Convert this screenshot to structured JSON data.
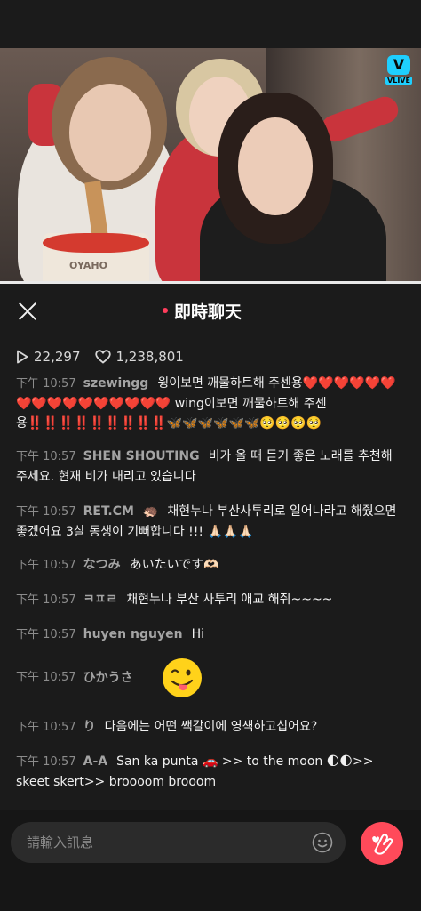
{
  "video": {
    "badge_label": "VLIVE",
    "cup_text": "OYAHO"
  },
  "chat": {
    "title": "即時聊天",
    "views": "22,297",
    "likes": "1,238,801"
  },
  "messages": [
    {
      "time": "下午 10:57",
      "user": "szewingg",
      "text_a": "윙이보면 깨물하트해 주센용",
      "hearts_a": "❤️❤️❤️❤️❤️",
      "hearts_b": "❤️❤️❤️❤️❤️❤️❤️❤️❤️❤️❤️",
      "text_b": " wing이보면 깨물하트해 주센",
      "text_c": "용",
      "bangs": "‼️‼️‼️‼️‼️‼️‼️‼️‼️",
      "butterflies": "🦋🦋🦋🦋🦋🦋",
      "pleading": "🥺🥺🥺🥺"
    },
    {
      "time": "下午 10:57",
      "user": "SHEN SHOUTING",
      "text": "비가 올 때 듣기 좋은 노래를 추천해 주세요. 현재 비가 내리고 있습니다"
    },
    {
      "time": "下午 10:57",
      "user": "RET.CM",
      "user_emoji": "🦔",
      "text": "채현누나 부산사투리로 일어나라고 해줬으면 좋겠어요 3살 동생이 기뻐합니다 !!! ",
      "hands": "🙏🏻🙏🏻🙏🏻"
    },
    {
      "time": "下午 10:57",
      "user": "なつみ",
      "text": "あいたいです",
      "emoji": "🫶🏻"
    },
    {
      "time": "下午 10:57",
      "user": "ㅋㅍㄹ",
      "text": "채현누나 부산 사투리 애교 해줘~~~~"
    },
    {
      "time": "下午 10:57",
      "user": "huyen nguyen",
      "text": "Hi"
    },
    {
      "time": "下午 10:57",
      "user": "ひかうさ",
      "sticker": "winking-tongue-face"
    },
    {
      "time": "下午 10:57",
      "user": "り",
      "text": "다음에는 어떤 쌕갈이에 영섁하고십어요?"
    },
    {
      "time": "下午 10:57",
      "user": "A-A",
      "text_a": "San ka punta ",
      "car": "🚗",
      "text_b": " >> to the moon ",
      "moons": "🌓🌓",
      "text_c": ">> skeet skert>> broooom brooom"
    }
  ],
  "input": {
    "placeholder": "請輸入訊息"
  },
  "colors": {
    "background": "#1b1b1b",
    "accent": "#ff4a5a",
    "vlive": "#1ecfff"
  }
}
